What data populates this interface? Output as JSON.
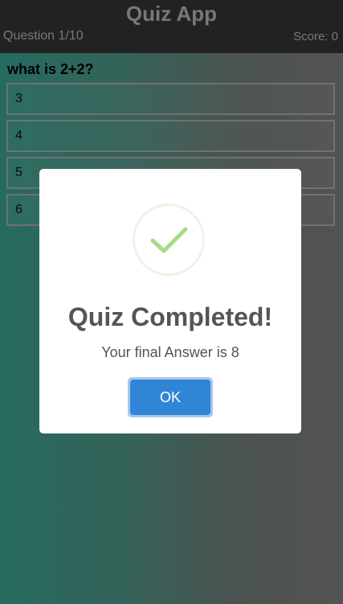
{
  "header": {
    "title": "Quiz App",
    "question_counter": "Question 1/10",
    "score": "Score: 0"
  },
  "question": {
    "text": "what is 2+2?",
    "options": [
      "3",
      "4",
      "5",
      "6"
    ]
  },
  "modal": {
    "icon": "checkmark-icon",
    "title": "Quiz Completed!",
    "message": "Your final Answer is 8",
    "ok_label": "OK"
  },
  "colors": {
    "header_bg": "#3a3a3a",
    "gradient_left": "#3fb3a0",
    "gradient_right": "#8a8a8a",
    "check_green": "#a5dc86",
    "ok_button": "#3085d6"
  }
}
